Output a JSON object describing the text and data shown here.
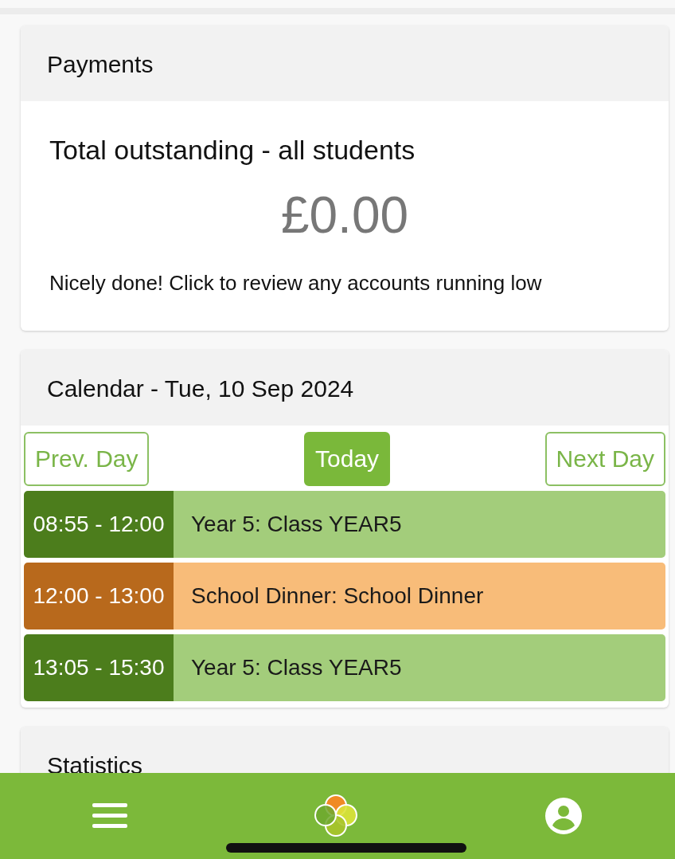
{
  "payments": {
    "title": "Payments",
    "subtitle": "Total outstanding - all students",
    "amount": "£0.00",
    "message": "Nicely done! Click to review any accounts running low"
  },
  "calendar": {
    "title": "Calendar - Tue, 10 Sep 2024",
    "buttons": [
      {
        "label": "Prev. Day",
        "kind": "outline"
      },
      {
        "label": "Today",
        "kind": "filled"
      },
      {
        "label": "Next Day",
        "kind": "outline"
      }
    ],
    "events": [
      {
        "time": "08:55 - 12:00",
        "title": "Year 5: Class YEAR5",
        "color": "#4c7d1c",
        "kind": "lesson"
      },
      {
        "time": "12:00 - 13:00",
        "title": "School Dinner: School Dinner",
        "color": "#b8691c",
        "kind": "meal"
      },
      {
        "time": "13:05 - 15:30",
        "title": "Year 5: Class YEAR5",
        "color": "#4c7d1c",
        "kind": "lesson"
      }
    ]
  },
  "statistics": {
    "title": "Statistics"
  }
}
